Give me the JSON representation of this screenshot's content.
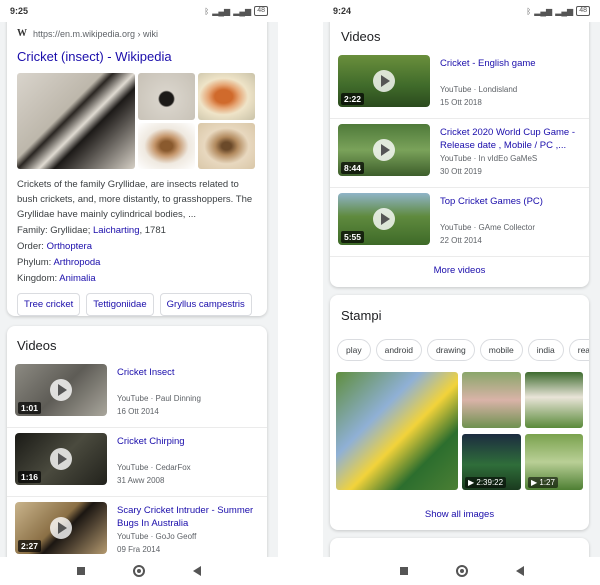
{
  "left": {
    "status": {
      "time": "9:25",
      "battery": "48"
    },
    "wiki": {
      "logo": "W",
      "url": "https://en.m.wikipedia.org › wiki",
      "title": "Cricket (insect) - Wikipedia",
      "description": "Crickets of the family Gryllidae, are insects related to bush crickets, and, more distantly, to grasshoppers. The Gryllidae have mainly cylindrical bodies, ...",
      "facts": [
        {
          "label": "Family: ",
          "value": "Gryllidae; ",
          "link": "Laicharting",
          "suffix": ", 1781"
        },
        {
          "label": "Order: ",
          "link": "Orthoptera"
        },
        {
          "label": "Phylum: ",
          "link": "Arthropoda"
        },
        {
          "label": "Kingdom: ",
          "link": "Animalia"
        }
      ],
      "chips": [
        "Tree cricket",
        "Tettigoniidae",
        "Gryllus campestris"
      ]
    },
    "videos": {
      "title": "Videos",
      "items": [
        {
          "title": "Cricket Insect",
          "source": "YouTube · Paul Dinning",
          "date": "16 Ott 2014",
          "duration": "1:01"
        },
        {
          "title": "Cricket Chirping",
          "source": "YouTube · CedarFox",
          "date": "31 Aww 2008",
          "duration": "1:16"
        },
        {
          "title": "Scary Cricket Intruder - Summer Bugs In Australia",
          "source": "YouTube · GoJo Geoff",
          "date": "09 Fra 2014",
          "duration": "2:27"
        }
      ]
    }
  },
  "right": {
    "status": {
      "time": "9:24",
      "battery": "48"
    },
    "videos": {
      "title": "Videos",
      "items": [
        {
          "title": "Cricket - English game",
          "source": "YouTube · Londisland",
          "date": "15 Ott 2018",
          "duration": "2:22"
        },
        {
          "title": "Cricket 2020 World Cup Game - Release date , Mobile / PC ,...",
          "source": "YouTube · In vIdEo GaMeS",
          "date": "30 Ott 2019",
          "duration": "8:44"
        },
        {
          "title": "Top Cricket Games (PC)",
          "source": "YouTube · GAme Collector",
          "date": "22 Ott 2014",
          "duration": "5:55"
        }
      ],
      "more": "More videos"
    },
    "images": {
      "title": "Stampi",
      "tags": [
        "play",
        "android",
        "drawing",
        "mobile",
        "india",
        "real"
      ],
      "durations": [
        "▶ 2:39:22",
        "▶ 1:27"
      ],
      "show_all": "Show all images"
    }
  },
  "colors": {
    "link": "#1a0dab",
    "meta": "#5f6368",
    "bg": "#f1f3f4"
  }
}
